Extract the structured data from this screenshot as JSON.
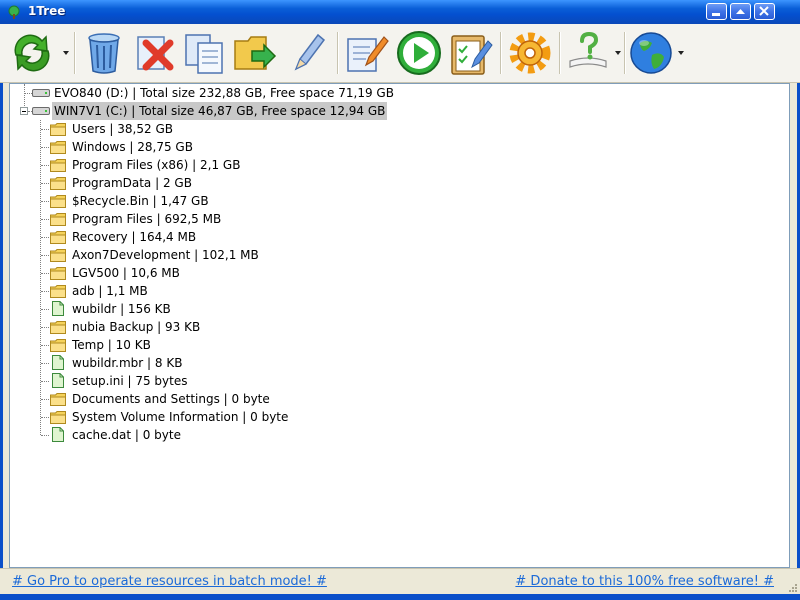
{
  "window": {
    "title": "1Tree"
  },
  "toolbar": {
    "buttons": [
      {
        "icon": "refresh-icon"
      },
      {
        "icon": "recycle-bin-icon"
      },
      {
        "icon": "delete-icon"
      },
      {
        "icon": "copy-icon"
      },
      {
        "icon": "move-icon"
      },
      {
        "icon": "rename-icon"
      },
      {
        "icon": "edit-icon"
      },
      {
        "icon": "run-icon"
      },
      {
        "icon": "checklist-icon"
      },
      {
        "icon": "settings-icon"
      },
      {
        "icon": "help-icon"
      },
      {
        "icon": "web-icon"
      }
    ]
  },
  "tree": {
    "drives": [
      {
        "label": "EVO840 (D:) | Total size 232,88 GB, Free space 71,19 GB",
        "expanded": false
      },
      {
        "label": "WIN7V1 (C:) | Total size 46,87 GB, Free space 12,94 GB",
        "expanded": true,
        "selected": true
      }
    ],
    "items": [
      {
        "type": "folder",
        "label": "Users | 38,52 GB"
      },
      {
        "type": "folder",
        "label": "Windows | 28,75 GB"
      },
      {
        "type": "folder",
        "label": "Program Files (x86) | 2,1 GB"
      },
      {
        "type": "folder",
        "label": "ProgramData | 2 GB"
      },
      {
        "type": "folder",
        "label": "$Recycle.Bin | 1,47 GB"
      },
      {
        "type": "folder",
        "label": "Program Files | 692,5 MB"
      },
      {
        "type": "folder",
        "label": "Recovery | 164,4 MB"
      },
      {
        "type": "folder",
        "label": "Axon7Development | 102,1 MB"
      },
      {
        "type": "folder",
        "label": "LGV500 | 10,6 MB"
      },
      {
        "type": "folder",
        "label": "adb | 1,1 MB"
      },
      {
        "type": "file",
        "label": "wubildr | 156 KB"
      },
      {
        "type": "folder",
        "label": "nubia Backup | 93 KB"
      },
      {
        "type": "folder",
        "label": "Temp | 10 KB"
      },
      {
        "type": "file",
        "label": "wubildr.mbr | 8 KB"
      },
      {
        "type": "file",
        "label": "setup.ini | 75 bytes"
      },
      {
        "type": "folder",
        "label": "Documents and Settings | 0 byte"
      },
      {
        "type": "folder",
        "label": "System Volume Information | 0 byte"
      },
      {
        "type": "file",
        "label": "cache.dat | 0 byte"
      }
    ]
  },
  "statusbar": {
    "left_link": "# Go Pro to operate resources in batch mode! #",
    "right_link": "# Donate to this 100% free software! #"
  },
  "colors": {
    "titlebar": "#0450d0",
    "link": "#1b6ad8",
    "folder": "#f5d25a",
    "file": "#dff5d0"
  }
}
